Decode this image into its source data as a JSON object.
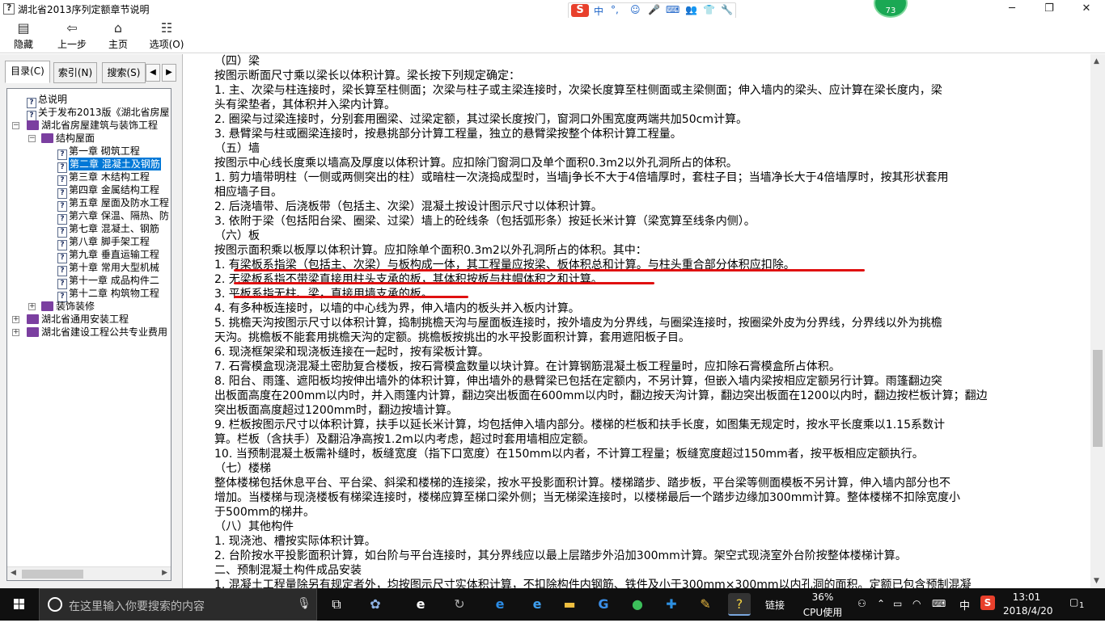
{
  "window": {
    "title": "湖北省2013序列定额章节说明",
    "controls": {
      "minimize": "─",
      "maximize": "❐",
      "close": "✕"
    }
  },
  "ime": {
    "logo": "S",
    "lang": "中",
    "items": [
      "°,",
      "☺",
      "🎤",
      "⌨",
      "👥",
      "👕",
      "🔧"
    ]
  },
  "badge": {
    "value": "73"
  },
  "toolbar": {
    "buttons": [
      {
        "label": "隐藏",
        "icon": "hide-icon"
      },
      {
        "label": "上一步",
        "icon": "back-arrow-icon"
      },
      {
        "label": "主页",
        "icon": "home-icon"
      },
      {
        "label": "选项(O)",
        "icon": "options-icon"
      }
    ]
  },
  "sidebar": {
    "tabs": [
      {
        "label": "目录(C)"
      },
      {
        "label": "索引(N)"
      },
      {
        "label": "搜索(S)"
      }
    ],
    "tree": [
      {
        "label": "总说明",
        "icon": "doc"
      },
      {
        "label": "关于发布2013版《湖北省房屋",
        "icon": "doc"
      },
      {
        "label": "湖北省房屋建筑与装饰工程",
        "icon": "book-open",
        "exp": "−"
      },
      {
        "label": "结构屋面",
        "icon": "book-open",
        "exp": "−"
      },
      {
        "label": "第一章 砌筑工程",
        "icon": "doc"
      },
      {
        "label": "第二章 混凝土及钢筋",
        "icon": "doc",
        "selected": true
      },
      {
        "label": "第三章 木结构工程",
        "icon": "doc"
      },
      {
        "label": "第四章 金属结构工程",
        "icon": "doc"
      },
      {
        "label": "第五章 屋面及防水工程",
        "icon": "doc"
      },
      {
        "label": "第六章 保温、隔热、防",
        "icon": "doc"
      },
      {
        "label": "第七章 混凝土、钢筋",
        "icon": "doc"
      },
      {
        "label": "第八章 脚手架工程",
        "icon": "doc"
      },
      {
        "label": "第九章 垂直运输工程",
        "icon": "doc"
      },
      {
        "label": "第十章 常用大型机械",
        "icon": "doc"
      },
      {
        "label": "第十一章 成品构件二",
        "icon": "doc"
      },
      {
        "label": "第十二章 构筑物工程",
        "icon": "doc"
      },
      {
        "label": "装饰装修",
        "icon": "book",
        "exp": "+"
      },
      {
        "label": "湖北省通用安装工程",
        "icon": "book",
        "exp": "+"
      },
      {
        "label": "湖北省建设工程公共专业费用",
        "icon": "book",
        "exp": "+"
      }
    ]
  },
  "content": {
    "lines": [
      "（四）梁",
      "按图示断面尺寸乘以梁长以体积计算。梁长按下列规定确定：",
      "1. 主、次梁与柱连接时，梁长算至柱侧面；次梁与柱子或主梁连接时，次梁长度算至柱侧面或主梁侧面；伸入墙内的梁头、应计算在梁长度内，梁",
      "头有梁垫者，其体积并入梁内计算。",
      "2. 圈梁与过梁连接时，分别套用圈梁、过梁定额，其过梁长度按门，窗洞口外围宽度两端共加50cm计算。",
      "3. 悬臂梁与柱或圈梁连接时，按悬挑部分计算工程量，独立的悬臂梁按整个体积计算工程量。",
      "（五）墙",
      "按图示中心线长度乘以墙高及厚度以体积计算。应扣除门窗洞口及单个面积0.3m2以外孔洞所占的体积。",
      "1. 剪力墙带明柱（一侧或两侧突出的柱）或暗柱一次浇捣成型时，当墙j争长不大于4倍墙厚时，套柱子目；当墙净长大于4倍墙厚时，按其形状套用",
      "相应墙子目。",
      "2. 后浇墙带、后浇板带（包括主、次梁）混凝土按设计图示尺寸以体积计算。",
      "3. 依附于梁（包括阳台梁、圈梁、过梁）墙上的砼线条（包括弧形条）按延长米计算（梁宽算至线条内侧）。",
      "（六）板",
      "按图示面积乘以板厚以体积计算。应扣除单个面积0.3m2以外孔洞所占的体积。其中：",
      "1. 有梁板系指梁（包括主、次梁）与板构成一体，其工程量应按梁、板体积总和计算。与柱头重合部分体积应扣除。",
      "2. 无梁板系指不带梁直接用柱头支承的板，其体积按板与柱帽体积之和计算。",
      "3. 平板系指无柱、梁，直接用墙支承的板。",
      "4. 有多种板连接时，以墙的中心线为界，伸入墙内的板头并入板内计算。",
      "5. 挑檐天沟按图示尺寸以体积计算，捣制挑檐天沟与屋面板连接时，按外墙皮为分界线，与圈梁连接时，按圈梁外皮为分界线，分界线以外为挑檐",
      "天沟。挑檐板不能套用挑檐天沟的定额。挑檐板按挑出的水平投影面积计算，套用遮阳板子目。",
      "6. 现浇框架梁和现浇板连接在一起时，按有梁板计算。",
      "7. 石膏模盒现浇混凝土密肋复合楼板，按石膏模盒数量以块计算。在计算钢筋混凝土板工程量时，应扣除石膏模盒所占体积。",
      "8. 阳台、雨篷、遮阳板均按伸出墙外的体积计算，伸出墙外的悬臂梁已包括在定额内，不另计算，但嵌入墙内梁按相应定额另行计算。雨篷翻边突",
      "出板面高度在200mm以内时，并入雨篷内计算，翻边突出板面在600mm以内时，翻边按天沟计算，翻边突出板面在1200以内时，翻边按栏板计算；翻边",
      "突出板面高度超过1200mm时，翻边按墙计算。",
      "9. 栏板按图示尺寸以体积计算，扶手以延长米计算，均包括伸入墙内部分。楼梯的栏板和扶手长度，如图集无规定时，按水平长度乘以1.15系数计",
      "算。栏板（含扶手）及翻沿净高按1.2m以内考虑，超过时套用墙相应定额。",
      "10. 当预制混凝土板需补缝时，板缝宽度（指下口宽度）在150mm以内者，不计算工程量；板缝宽度超过150mm者，按平板相应定额执行。",
      "（七）楼梯",
      "整体楼梯包括休息平台、平台梁、斜梁和楼梯的连接梁，按水平投影面积计算。楼梯踏步、踏步板，平台梁等侧面模板不另计算，伸入墙内部分也不",
      "增加。当楼梯与现浇楼板有梯梁连接时，楼梯应算至梯口梁外侧；当无梯梁连接时，以楼梯最后一个踏步边缘加300mm计算。整体楼梯不扣除宽度小",
      "于500mm的梯井。",
      "（八）其他构件",
      "1. 现浇池、槽按实际体积计算。",
      "2. 台阶按水平投影面积计算，如台阶与平台连接时，其分界线应以最上层踏步外沿加300mm计算。架空式现浇室外台阶按整体楼梯计算。",
      "二、预制混凝土构件成品安装",
      "1. 混凝土工程量除另有规定者外，均按图示尺寸实体积计算，不扣除构件内钢筋、铁件及小于300mm×300mm以内孔洞的面积。定额已包含预制混凝"
    ]
  },
  "taskbar": {
    "search_placeholder": "在这里输入你要搜索的内容",
    "apps": [
      "task-view",
      "pinwheel",
      "ie-e",
      "refresh-spiral",
      "edge",
      "ie",
      "folder",
      "g-browser",
      "green-circle",
      "plus-app",
      "notes",
      "help-app"
    ],
    "tray": {
      "link": "链接",
      "cpu_percent": "36%",
      "cpu_label": "CPU使用",
      "ime": "中",
      "time": "13:01",
      "date": "2018/4/20",
      "notification_count": "1"
    }
  }
}
